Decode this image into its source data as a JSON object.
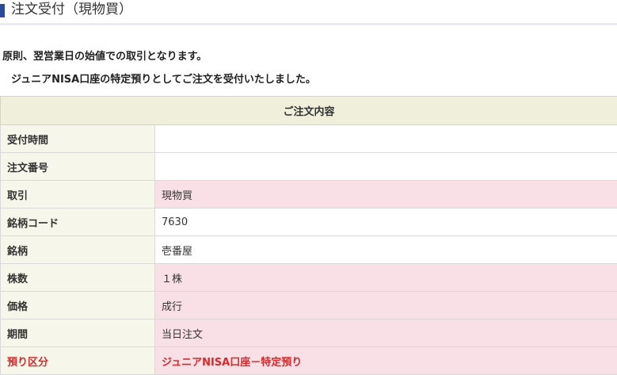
{
  "header": {
    "title": "注文受付（現物買）"
  },
  "notices": {
    "line1": "原則、翌営業日の始値での取引となります。",
    "line2": "ジュニアNISA口座の特定預りとしてご注文を受付いたしました。"
  },
  "order_table": {
    "heading": "ご注文内容",
    "rows": [
      {
        "label": "受付時間",
        "value": ""
      },
      {
        "label": "注文番号",
        "value": ""
      },
      {
        "label": "取引",
        "value": "現物買"
      },
      {
        "label": "銘柄コード",
        "value": "7630"
      },
      {
        "label": "銘柄",
        "value": "壱番屋"
      },
      {
        "label": "株数",
        "value": "１株"
      },
      {
        "label": "価格",
        "value": "成行"
      },
      {
        "label": "期間",
        "value": "当日注文"
      },
      {
        "label": "預り区分",
        "value": "ジュニアNISA口座－特定預り"
      }
    ]
  },
  "colors": {
    "title_marker": "#2a4a9a",
    "table_heading_bg": "#efefdc",
    "label_bg": "#f7f6ea",
    "highlight_bg": "#f8e0e6",
    "alert_text": "#d42c2c"
  }
}
